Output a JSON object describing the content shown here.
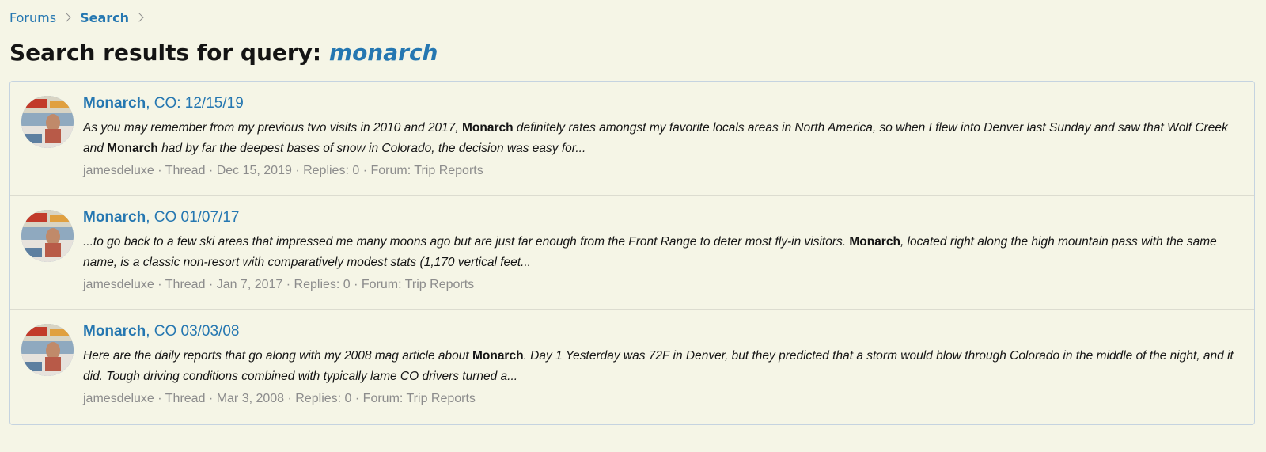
{
  "breadcrumb": {
    "items": [
      "Forums",
      "Search"
    ]
  },
  "header": {
    "title_prefix": "Search results for query:",
    "query": "monarch"
  },
  "colors": {
    "background": "#f5f5e6",
    "link": "#2577b1",
    "muted": "#8c8c8c",
    "border": "#c5d3e0"
  },
  "results": [
    {
      "title_hl": "Monarch",
      "title_rest": ", CO: 12/15/19",
      "snippet": [
        {
          "t": "As you may remember from my previous two visits in 2010 and 2017, ",
          "hl": false
        },
        {
          "t": "Monarch",
          "hl": true
        },
        {
          "t": " definitely rates amongst my favorite locals areas in North America, so when I flew into Denver last Sunday and saw that Wolf Creek and ",
          "hl": false
        },
        {
          "t": "Monarch",
          "hl": true
        },
        {
          "t": " had by far the deepest bases of snow in Colorado, the decision was easy for...",
          "hl": false
        }
      ],
      "author": "jamesdeluxe",
      "type": "Thread",
      "date": "Dec 15, 2019",
      "replies": "Replies: 0",
      "forum": "Forum: Trip Reports",
      "avatar_icon": "avatar-magazine-cover-icon"
    },
    {
      "title_hl": "Monarch",
      "title_rest": ", CO 01/07/17",
      "snippet": [
        {
          "t": "...to go back to a few ski areas that impressed me many moons ago but are just far enough from the Front Range to deter most fly-in visitors. ",
          "hl": false
        },
        {
          "t": "Monarch",
          "hl": true
        },
        {
          "t": ", located right along the high mountain pass with the same name, is a classic non-resort with comparatively modest stats (1,170 vertical feet...",
          "hl": false
        }
      ],
      "author": "jamesdeluxe",
      "type": "Thread",
      "date": "Jan 7, 2017",
      "replies": "Replies: 0",
      "forum": "Forum: Trip Reports",
      "avatar_icon": "avatar-magazine-cover-icon"
    },
    {
      "title_hl": "Monarch",
      "title_rest": ", CO 03/03/08",
      "snippet": [
        {
          "t": "Here are the daily reports that go along with my 2008 mag article about ",
          "hl": false
        },
        {
          "t": "Monarch",
          "hl": true
        },
        {
          "t": ". Day 1 Yesterday was 72F in Denver, but they predicted that a storm would blow through Colorado in the middle of the night, and it did. Tough driving conditions combined with typically lame CO drivers turned a...",
          "hl": false
        }
      ],
      "author": "jamesdeluxe",
      "type": "Thread",
      "date": "Mar 3, 2008",
      "replies": "Replies: 0",
      "forum": "Forum: Trip Reports",
      "avatar_icon": "avatar-magazine-cover-icon"
    }
  ]
}
